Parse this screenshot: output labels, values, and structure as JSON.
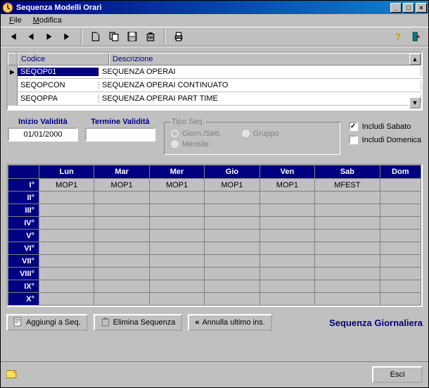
{
  "window": {
    "title": "Sequenza Modelli Orari"
  },
  "menu": {
    "file": "File",
    "file_ul": "F",
    "modifica": "Modifica",
    "modifica_ul": "M"
  },
  "list": {
    "headers": {
      "codice": "Codice",
      "descrizione": "Descrizione"
    },
    "rows": [
      {
        "codice": "SEQOP01",
        "descrizione": "SEQUENZA OPERAI",
        "selected": true
      },
      {
        "codice": "SEQOPCON",
        "descrizione": "SEQUENZA OPERAI CONTINUATO",
        "selected": false
      },
      {
        "codice": "SEQOPPA",
        "descrizione": "SEQUENZA OPERAI PART TIME",
        "selected": false
      }
    ]
  },
  "validity": {
    "inizio_label": "Inizio Validità",
    "inizio_value": "01/01/2000",
    "termine_label": "Termine Validità",
    "termine_value": ""
  },
  "tipo": {
    "legend": "Tipo Seq.",
    "giorn": "Giorn./Sett.",
    "gruppo": "Gruppo",
    "mensile": "Mensile",
    "selected": "giorn"
  },
  "includes": {
    "sabato_label": "Includi Sabato",
    "sabato_checked": true,
    "domenica_label": "Includi Domenica",
    "domenica_checked": false
  },
  "grid": {
    "cols": [
      "Lun",
      "Mar",
      "Mer",
      "Gio",
      "Ven",
      "Sab",
      "Dom"
    ],
    "row_labels": [
      "I°",
      "II°",
      "III°",
      "IV°",
      "V°",
      "VI°",
      "VII°",
      "VIII°",
      "IX°",
      "X°"
    ],
    "data": [
      [
        "MOP1",
        "MOP1",
        "MOP1",
        "MOP1",
        "MOP1",
        "MFEST",
        ""
      ],
      [
        "",
        "",
        "",
        "",
        "",
        "",
        ""
      ],
      [
        "",
        "",
        "",
        "",
        "",
        "",
        ""
      ],
      [
        "",
        "",
        "",
        "",
        "",
        "",
        ""
      ],
      [
        "",
        "",
        "",
        "",
        "",
        "",
        ""
      ],
      [
        "",
        "",
        "",
        "",
        "",
        "",
        ""
      ],
      [
        "",
        "",
        "",
        "",
        "",
        "",
        ""
      ],
      [
        "",
        "",
        "",
        "",
        "",
        "",
        ""
      ],
      [
        "",
        "",
        "",
        "",
        "",
        "",
        ""
      ],
      [
        "",
        "",
        "",
        "",
        "",
        "",
        ""
      ]
    ]
  },
  "buttons": {
    "aggiungi": "Aggiungi a Seq.",
    "elimina": "Elimina Sequenza",
    "annulla": "Annulla ultimo ins.",
    "esci": "Esci"
  },
  "seq_label": "Sequenza Giornaliera",
  "icons": {
    "first": "first-icon",
    "prev": "prev-icon",
    "next": "next-icon",
    "last": "last-icon",
    "new": "new-document-icon",
    "copy": "copy-icon",
    "save": "save-icon",
    "delete": "delete-icon",
    "print": "print-icon",
    "help": "help-icon",
    "exit": "door-exit-icon",
    "app": "clock-icon",
    "footer": "note-icon"
  }
}
